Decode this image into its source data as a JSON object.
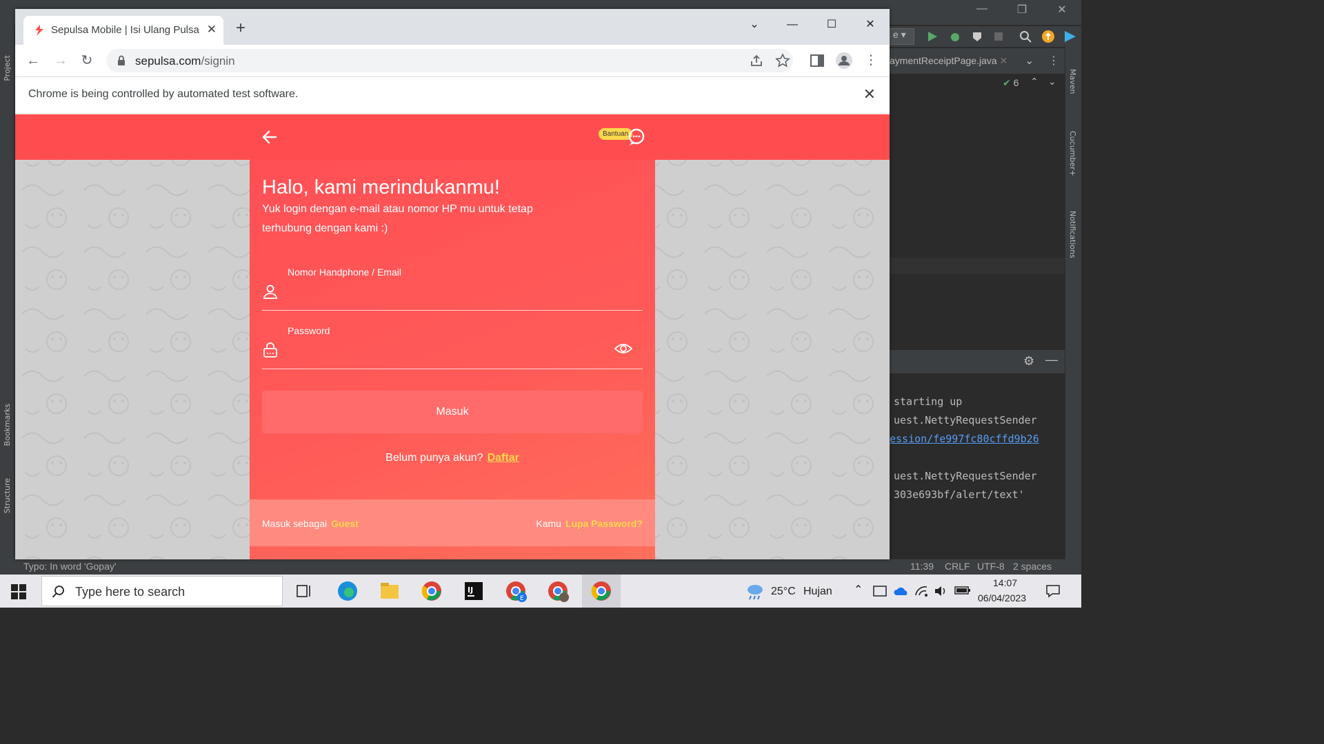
{
  "ide": {
    "tab_label": "aymentReceiptPage.java",
    "run_config_label": "e",
    "inspection_count": "6",
    "left_tools": [
      "Project",
      "Bookmarks",
      "Structure"
    ],
    "right_tools": [
      "Maven",
      "Cucumber+",
      "Notifications"
    ],
    "console_lines": [
      "starting up",
      "uest.NettyRequestSender",
      "ession/fe997fc80cffd9b26",
      "uest.NettyRequestSender",
      "303e693bf/alert/text'"
    ],
    "status": {
      "message": "Typo: In word 'Gopay'",
      "position": "11:39",
      "line_sep": "CRLF",
      "encoding": "UTF-8",
      "indent": "2 spaces"
    }
  },
  "browser": {
    "tab_title": "Sepulsa Mobile | Isi Ulang Pulsa S",
    "url_host": "sepulsa.com",
    "url_path": "/signin",
    "infobar_text": "Chrome is being controlled by automated test software."
  },
  "page": {
    "help_label": "Bantuan",
    "greeting": "Halo, kami merindukanmu!",
    "subtitle": "Yuk login dengan e-mail atau nomor HP mu untuk tetap terhubung dengan kami :)",
    "phone_email_label": "Nomor Handphone / Email",
    "phone_email_value": "",
    "password_label": "Password",
    "password_value": "",
    "login_button": "Masuk",
    "no_account_text": "Belum punya akun?",
    "register_link": "Daftar",
    "guest_prefix": "Masuk sebagai",
    "guest_link": "Guest",
    "forgot_prefix": "Kamu",
    "forgot_link": "Lupa Password?",
    "colors": {
      "brand_red": "#ff4d4f",
      "accent_yellow": "#ffd84d"
    }
  },
  "taskbar": {
    "search_placeholder": "Type here to search",
    "weather_temp": "25°C",
    "weather_text": "Hujan",
    "time": "14:07",
    "date": "06/04/2023"
  }
}
